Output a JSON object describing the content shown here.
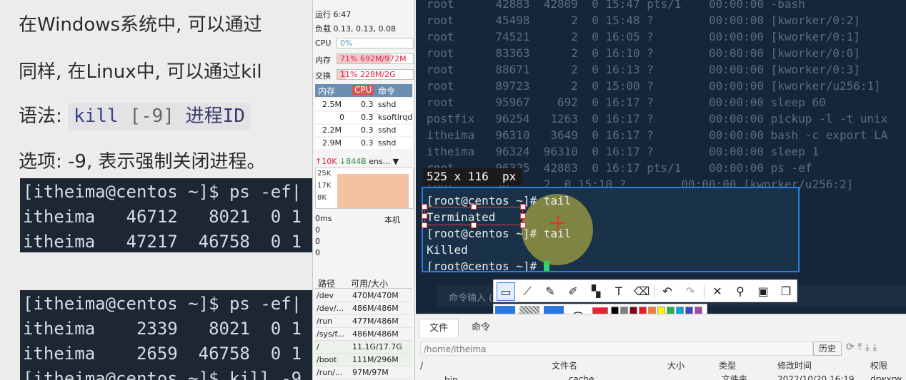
{
  "doc": {
    "line1": "在Windows系统中, 可以通过",
    "line2": "同样, 在Linux中, 可以通过kil",
    "syntax_prefix": "语法:",
    "syntax_kw": "kill",
    "syntax_arg": "[-9]",
    "syntax_tail": "进程ID",
    "options": "选项: -9, 表示强制关闭进程。",
    "block1": [
      "[itheima@centos ~]$ ps -ef|",
      "itheima   46712   8021  0 1",
      "itheima   47217  46758  0 1"
    ],
    "block2": [
      "[itheima@centos ~]$ ps -ef|",
      "itheima    2339   8021  0 1",
      "itheima    2659  46758  0 1",
      "[itheima@centos ~]$ kill -9"
    ]
  },
  "monitor": {
    "uptime": "运行 6:47",
    "load": "负载 0.13, 0.13, 0.08",
    "cpu_label": "CPU",
    "cpu_value": "0%",
    "cpu_pct": 0,
    "mem_label": "内存",
    "mem_value": "71% 692M/972M",
    "mem_pct": 71,
    "swap_label": "交换",
    "swap_value": "11%     228M/2G",
    "swap_pct": 11,
    "proc_cols": [
      "内存",
      "CPU",
      "命令"
    ],
    "procs": [
      {
        "mem": "2.5M",
        "cpu": "0.3",
        "cmd": "sshd"
      },
      {
        "mem": "0",
        "cpu": "0.3",
        "cmd": "ksoftirqd"
      },
      {
        "mem": "2.2M",
        "cpu": "0.3",
        "cmd": "sshd"
      },
      {
        "mem": "2.9M",
        "cpu": "0.3",
        "cmd": "sshd"
      }
    ],
    "net_up": "↑10K",
    "net_down": "↓844B",
    "net_iface": "ens...",
    "graph_ticks": [
      "25K",
      "17K",
      "8K"
    ],
    "latency_label": "0ms",
    "latency_host": "本机",
    "latency_ticks": [
      "0",
      "0",
      "0"
    ],
    "disk_cols": [
      "路径",
      "可用/大小"
    ],
    "disks": [
      {
        "path": "/dev",
        "size": "470M/470M"
      },
      {
        "path": "/dev/...",
        "size": "486M/486M"
      },
      {
        "path": "/run",
        "size": "477M/486M"
      },
      {
        "path": "/sys/f...",
        "size": "486M/486M"
      },
      {
        "path": "/",
        "size": "11.1G/17.7G"
      },
      {
        "path": "/boot",
        "size": "111M/296M"
      },
      {
        "path": "/run/...",
        "size": "97M/97M"
      }
    ]
  },
  "terminal": {
    "ps_rows": [
      "root      42883  42809  0 15:47 pts/1    00:00:00 -bash",
      "root      45498      2  0 15:48 ?        00:00:00 [kworker/0:2]",
      "root      74521      2  0 16:05 ?        00:00:00 [kworker/0:1]",
      "root      83363      2  0 16:10 ?        00:00:00 [kworker/0:0]",
      "root      88671      2  0 16:13 ?        00:00:00 [kworker/0:3]",
      "root      89723      2  0 15:00 ?        00:00:00 [kworker/u256:1]",
      "root      95967    692  0 16:17 ?        00:00:00 sleep 60",
      "postfix   96254   1263  0 16:17 ?        00:00:00 pickup -l -t unix",
      "itheima   96310   3649  0 16:17 ?        00:00:00 bash -c export LA",
      "itheima   96324  96310  0 16:17 ?        00:00:00 sleep 1",
      "root      96325  42883  0 16:17 pts/1    00:00:00 ps -ef",
      "root      96     2  0 15:10 ?        00:00:00 [kworker/u256:2]"
    ],
    "cmd_input_label": "命令输入 (",
    "capture_lines": [
      "[root@centos ~]# tail",
      "Terminated",
      "[root@centos ~]# tail",
      "Killed",
      "[root@centos ~]# "
    ]
  },
  "capture": {
    "size_label": "525 x 116  px"
  },
  "toolbar": {
    "tools": [
      "rect-tool",
      "polyline-tool",
      "pen-tool",
      "marker-tool",
      "mosaic-tool",
      "text-tool",
      "eraser-tool"
    ],
    "actions": [
      "undo",
      "redo",
      "cancel",
      "pin",
      "save",
      "copy"
    ]
  },
  "palette": {
    "current": "#e3262d",
    "swatches_top": [
      "#000000",
      "#7f7f7f",
      "#880015",
      "#ed1c24",
      "#ff7f27",
      "#fff200",
      "#22b14c",
      "#00a2e8",
      "#3f48cc",
      "#a349a4"
    ],
    "swatches_bottom": [
      "#ffffff",
      "#c3c3c3",
      "#b97a57",
      "#ffaec9",
      "#ffc90e",
      "#efe4b0",
      "#b5e61d",
      "#99d9ea",
      "#7092be",
      "#c8bfe7"
    ]
  },
  "files": {
    "tab_files": "文件",
    "tab_cmd": "命令",
    "path": "/home/itheima",
    "history": "历史",
    "tree_root": "/",
    "tree_bin": "bin",
    "cols": [
      "文件名",
      "大小",
      "类型",
      "修改时间",
      "权限"
    ],
    "row_name": ".cache",
    "row_type": "文件夹",
    "row_time": "2022/10/20 16:19",
    "row_perm": "drwxrw"
  }
}
